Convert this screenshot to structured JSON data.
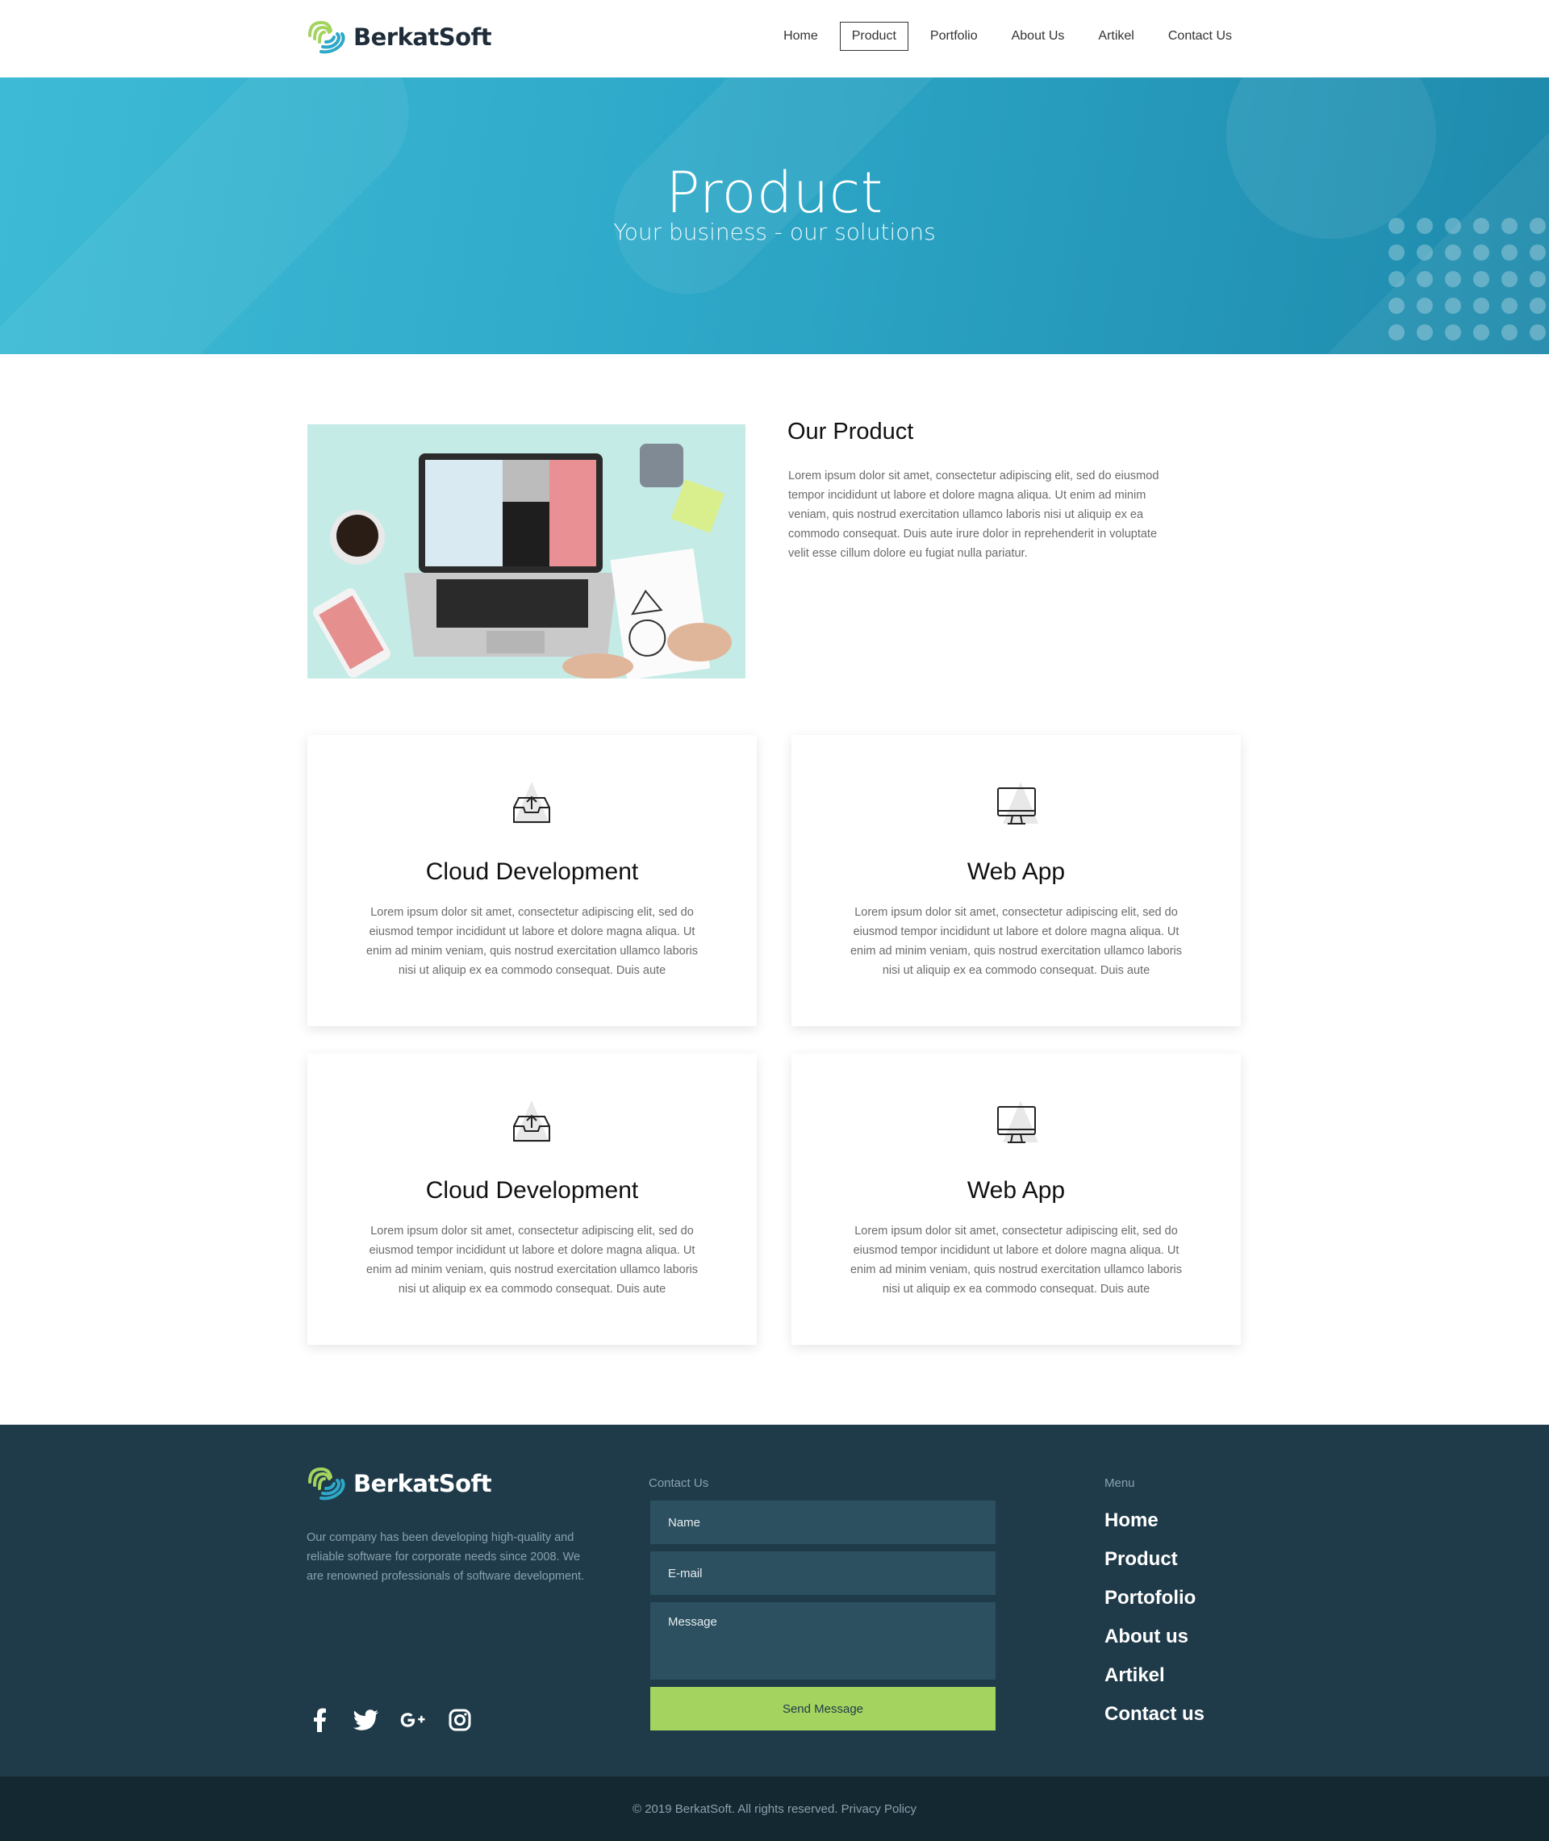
{
  "brand": {
    "name": "BerkatSoft",
    "colors": {
      "primary_green": "#a5d35f",
      "primary_blue": "#2ea8c8",
      "footer_bg": "#1f3b4a"
    }
  },
  "nav": {
    "items": [
      {
        "label": "Home",
        "active": false
      },
      {
        "label": "Product",
        "active": true
      },
      {
        "label": "Portfolio",
        "active": false
      },
      {
        "label": "About Us",
        "active": false
      },
      {
        "label": "Artikel",
        "active": false
      },
      {
        "label": "Contact Us",
        "active": false
      }
    ]
  },
  "hero": {
    "title": "Product",
    "subtitle": "Your business - our solutions"
  },
  "intro": {
    "title": "Our Product",
    "text": "Lorem ipsum dolor sit amet, consectetur adipiscing elit, sed do eiusmod tempor incididunt ut labore et dolore magna aliqua. Ut enim ad minim veniam, quis nostrud exercitation ullamco laboris nisi ut aliquip ex ea commodo consequat. Duis aute irure dolor in reprehenderit in voluptate velit esse cillum dolore eu fugiat nulla pariatur.",
    "image_icon": "laptop-workspace-photo"
  },
  "cards": [
    {
      "title": "Cloud Development",
      "icon": "cloud-upload-icon",
      "text": "Lorem ipsum dolor sit amet, consectetur adipiscing elit, sed do eiusmod tempor incididunt ut labore et dolore magna aliqua. Ut enim ad minim veniam, quis nostrud exercitation ullamco laboris nisi ut aliquip ex ea commodo consequat. Duis aute"
    },
    {
      "title": "Web App",
      "icon": "monitor-icon",
      "text": "Lorem ipsum dolor sit amet, consectetur adipiscing elit, sed do eiusmod tempor incididunt ut labore et dolore magna aliqua. Ut enim ad minim veniam, quis nostrud exercitation ullamco laboris nisi ut aliquip ex ea commodo consequat. Duis aute"
    },
    {
      "title": "Cloud Development",
      "icon": "cloud-upload-icon",
      "text": "Lorem ipsum dolor sit amet, consectetur adipiscing elit, sed do eiusmod tempor incididunt ut labore et dolore magna aliqua. Ut enim ad minim veniam, quis nostrud exercitation ullamco laboris nisi ut aliquip ex ea commodo consequat. Duis aute"
    },
    {
      "title": "Web App",
      "icon": "monitor-icon",
      "text": "Lorem ipsum dolor sit amet, consectetur adipiscing elit, sed do eiusmod tempor incididunt ut labore et dolore magna aliqua. Ut enim ad minim veniam, quis nostrud exercitation ullamco laboris nisi ut aliquip ex ea commodo consequat. Duis aute"
    }
  ],
  "footer": {
    "description": "Our company has been developing high-quality and reliable software for corporate needs since 2008. We are renowned professionals of software development.",
    "socials": [
      "facebook-icon",
      "twitter-icon",
      "google-plus-icon",
      "instagram-icon"
    ],
    "contact": {
      "label": "Contact Us",
      "name_placeholder": "Name",
      "email_placeholder": "E-mail",
      "message_placeholder": "Message",
      "send_label": "Send Message"
    },
    "menu": {
      "label": "Menu",
      "items": [
        "Home",
        "Product",
        "Portofolio",
        "About us",
        "Artikel",
        "Contact us"
      ]
    },
    "copyright": "© 2019 BerkatSoft. All rights reserved. Privacy Policy"
  }
}
